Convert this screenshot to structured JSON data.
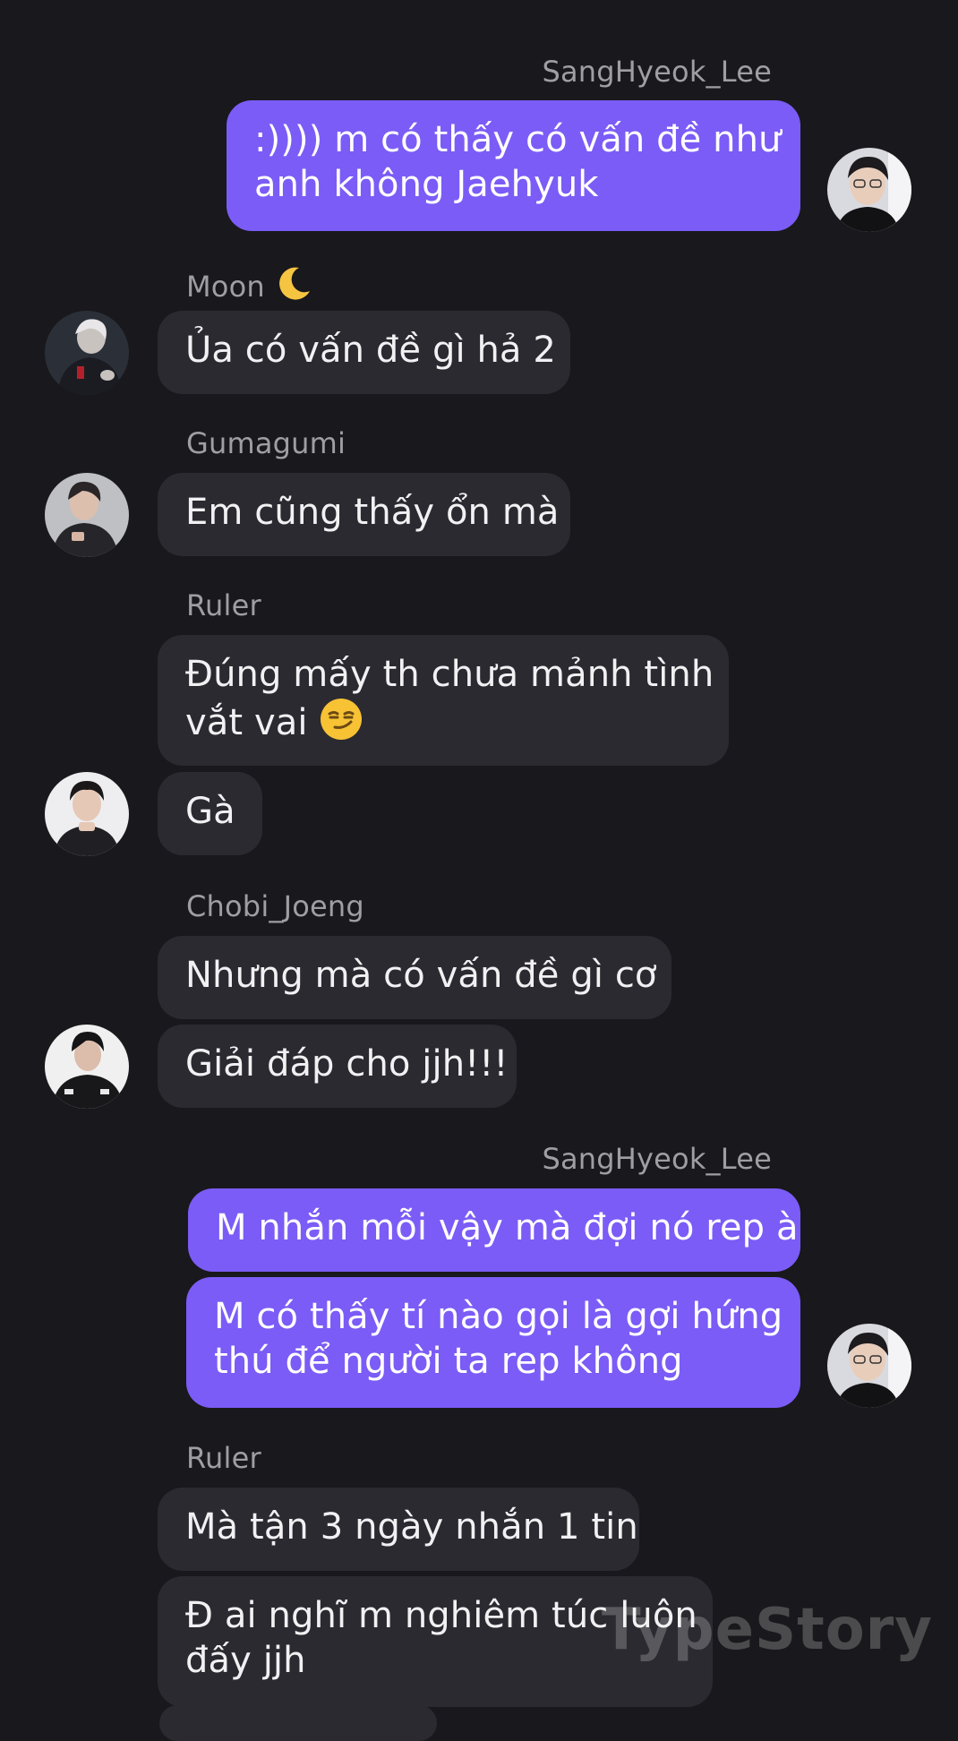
{
  "colors": {
    "background": "#19181c",
    "incoming_bubble": "#2b2a30",
    "outgoing_bubble": "#7b5cf6",
    "sender_name": "#9e9ea3"
  },
  "messages": {
    "m1": {
      "sender": "SangHyeok_Lee",
      "lines": [
        ":)))) m có thấy có vấn đề như",
        "anh không Jaehyuk"
      ]
    },
    "m2": {
      "sender": "Moon",
      "sender_emoji": "crescent-moon",
      "text": "Ủa có vấn đề gì hả 2"
    },
    "m3": {
      "sender": "Gumagumi",
      "text": "Em cũng thấy ổn mà"
    },
    "m4": {
      "sender": "Ruler",
      "lines": [
        "Đúng mấy th chưa mảnh tình",
        "vắt vai"
      ],
      "emoji": "smirking-face",
      "text2": "Gà"
    },
    "m5": {
      "sender": "Chobi_Joeng",
      "text": "Nhưng mà có vấn đề gì cơ",
      "text2": "Giải đáp cho jjh!!!"
    },
    "m6": {
      "sender": "SangHyeok_Lee",
      "text": "M nhắn mỗi vậy mà đợi nó rep à",
      "lines": [
        "M có thấy tí nào gọi là gợi hứng",
        "thú để người ta rep không"
      ]
    },
    "m7": {
      "sender": "Ruler",
      "text": "Mà tận 3 ngày nhắn 1 tin",
      "lines": [
        "Đ ai nghĩ m nghiêm túc luôn",
        "đấy jjh"
      ]
    }
  },
  "watermark": "TypeStory"
}
